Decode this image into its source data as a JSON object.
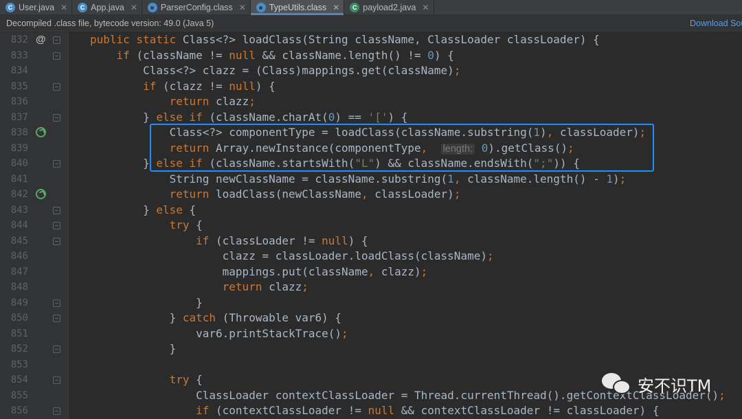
{
  "tabs": [
    {
      "label": "User.java",
      "icon": "java-class-icon"
    },
    {
      "label": "App.java",
      "icon": "java-class-icon"
    },
    {
      "label": "ParserConfig.class",
      "icon": "class-file-icon"
    },
    {
      "label": "TypeUtils.class",
      "icon": "class-file-icon",
      "active": true
    },
    {
      "label": "payload2.java",
      "icon": "java-file-icon"
    }
  ],
  "banner": {
    "message": "Decompiled .class file, bytecode version: 49.0 (Java 5)",
    "download_link": "Download Sources"
  },
  "editor": {
    "line_numbers": [
      "832",
      "833",
      "834",
      "835",
      "836",
      "837",
      "838",
      "839",
      "840",
      "841",
      "842",
      "843",
      "844",
      "845",
      "846",
      "847",
      "848",
      "849",
      "850",
      "851",
      "852",
      "853",
      "854",
      "855",
      "856"
    ],
    "hint_label": "length:"
  },
  "watermark": {
    "text": "安不识TM"
  },
  "colors": {
    "keyword": "#cc7832",
    "string": "#6a8759",
    "number": "#6897bb",
    "highlight_box": "#1e90ff",
    "text": "#a9b7c6"
  }
}
